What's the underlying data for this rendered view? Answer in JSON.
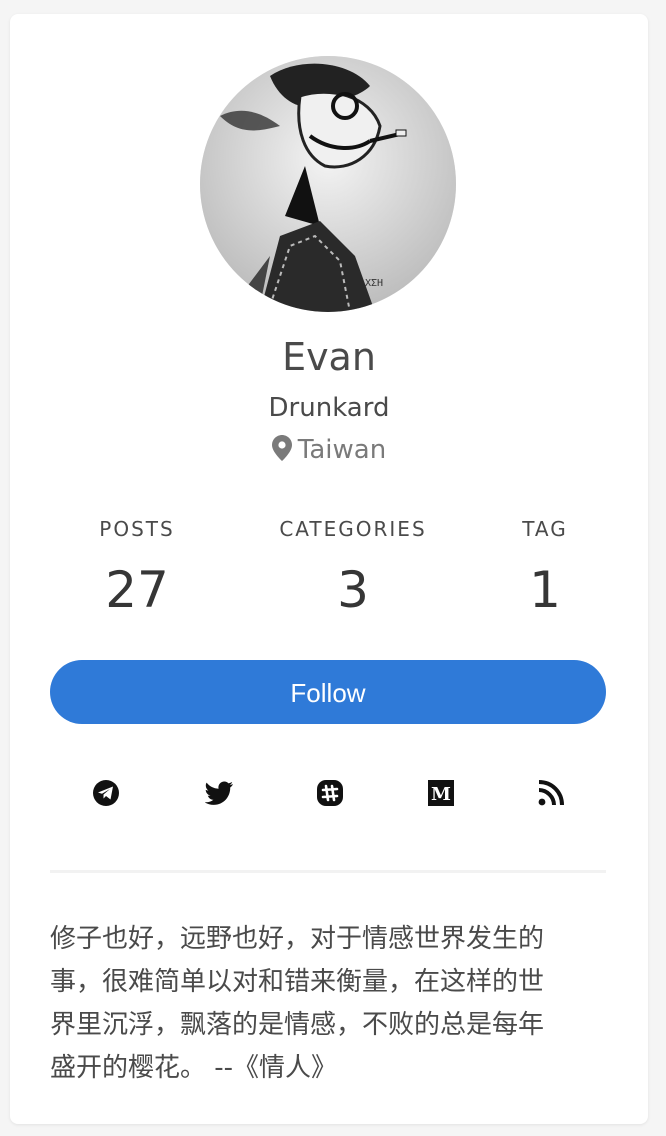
{
  "profile": {
    "name": "Evan",
    "subtitle": "Drunkard",
    "location": "Taiwan"
  },
  "stats": [
    {
      "label": "POSTS",
      "value": "27"
    },
    {
      "label": "CATEGORIES",
      "value": "3"
    },
    {
      "label": "TAG",
      "value": "1"
    }
  ],
  "follow_label": "Follow",
  "social_icons": [
    "telegram-icon",
    "twitter-icon",
    "slack-icon",
    "medium-icon",
    "rss-icon"
  ],
  "bio": {
    "lines": [
      "修子也好，远野也好，对于情感世界发生的",
      "事，很难简单以对和错来衡量，在这样的世",
      "界里沉浮，飘落的是情感，不败的总是每年",
      "盛开的樱花。 --《情人》"
    ]
  },
  "colors": {
    "accent": "#2f7ad8",
    "text": "#4a4a4a",
    "muted": "#7a7a7a"
  }
}
